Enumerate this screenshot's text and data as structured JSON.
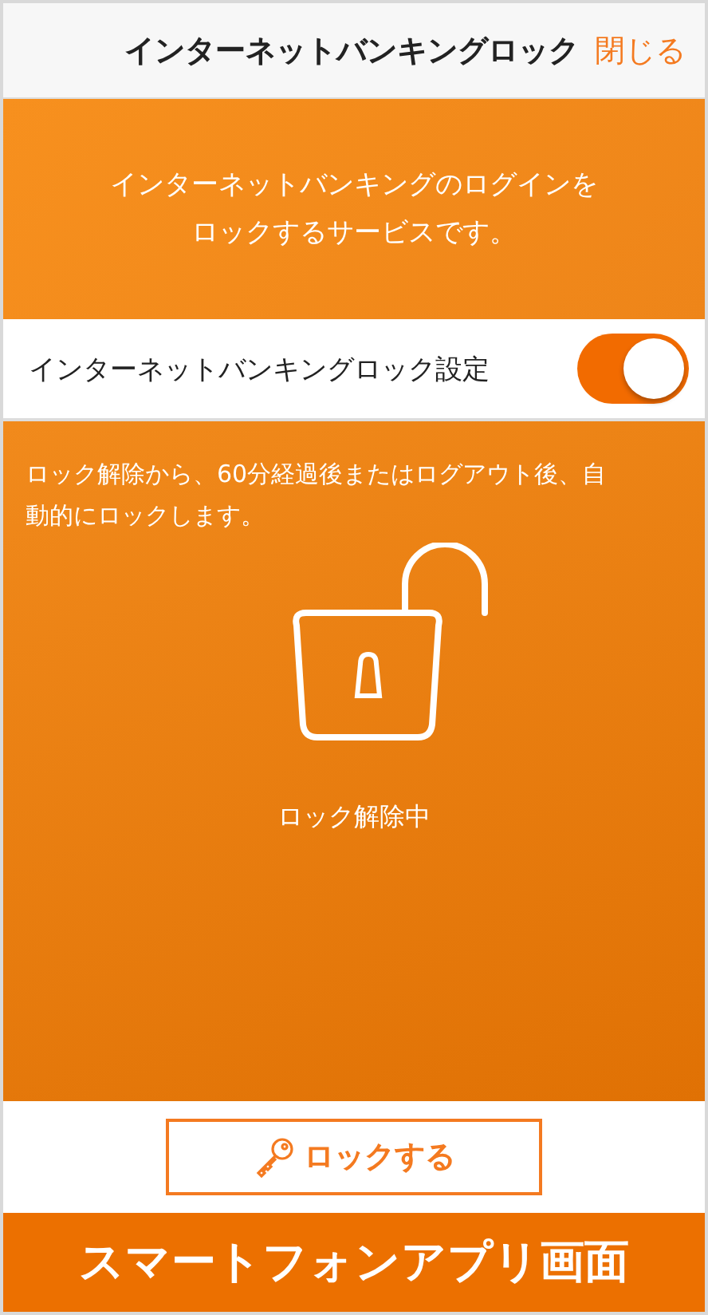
{
  "header": {
    "title": "インターネットバンキングロック",
    "close": "閉じる"
  },
  "intro": {
    "lines": [
      "インターネットバンキングのログインを",
      "ロックするサービスです。"
    ]
  },
  "setting": {
    "label": "インターネットバンキングロック設定",
    "on": true
  },
  "status": {
    "note_lines": [
      "ロック解除から、60分経過後またはログアウト後、自",
      "動的にロックします。"
    ],
    "locked": false,
    "label": "ロック解除中"
  },
  "action": {
    "label": "ロックする"
  },
  "footer": {
    "caption": "スマートフォンアプリ画面"
  }
}
